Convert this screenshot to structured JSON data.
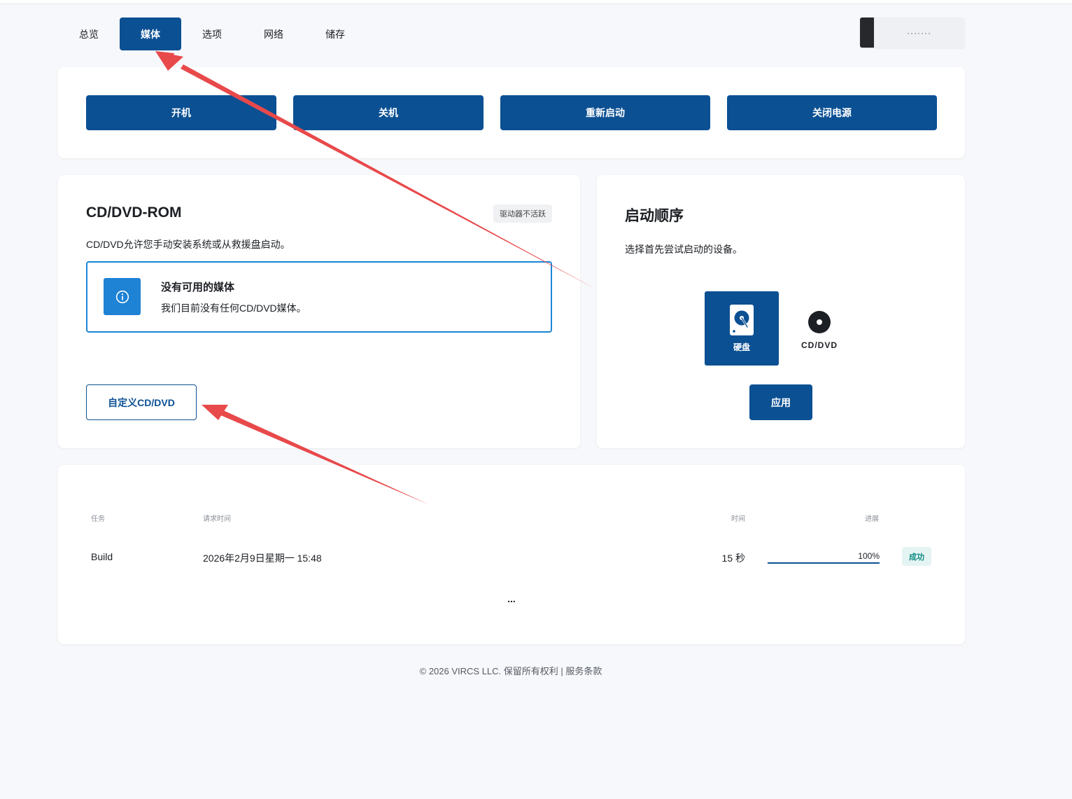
{
  "tabs": [
    {
      "label": "总览",
      "active": false
    },
    {
      "label": "媒体",
      "active": true
    },
    {
      "label": "选项",
      "active": false
    },
    {
      "label": "网络",
      "active": false
    },
    {
      "label": "储存",
      "active": false
    }
  ],
  "user": {
    "masked": "·······"
  },
  "power": {
    "on": "开机",
    "shutdown": "关机",
    "restart": "重新启动",
    "poweroff": "关闭电源"
  },
  "cd": {
    "title": "CD/DVD-ROM",
    "badge": "驱动器不活跃",
    "desc": "CD/DVD允许您手动安装系统或从救援盘启动。",
    "media_title": "没有可用的媒体",
    "media_sub": "我们目前没有任何CD/DVD媒体。",
    "custom_button": "自定义CD/DVD"
  },
  "boot": {
    "title": "启动顺序",
    "desc": "选择首先尝试启动的设备。",
    "devices": [
      {
        "label": "硬盘",
        "icon": "hard-disk-icon",
        "selected": true
      },
      {
        "label": "CD/DVD",
        "icon": "disc-icon",
        "selected": false
      }
    ],
    "apply": "应用"
  },
  "tasks": {
    "headers": {
      "task": "任务",
      "requested": "请求时间",
      "time": "时间",
      "progress": "进展"
    },
    "rows": [
      {
        "task": "Build",
        "requested": "2026年2月9日星期一 15:48",
        "time": "15 秒",
        "progress_label": "100%",
        "progress": 1.0,
        "status": "成功"
      }
    ],
    "more": "..."
  },
  "footer": "© 2026 VIRCS LLC. 保留所有权利 | 服务条款",
  "colors": {
    "primary": "#0b5093",
    "info": "#1e82d5",
    "success_bg": "#e4f4f3",
    "success_text": "#0f8a84",
    "annotation": "#e8494b"
  }
}
